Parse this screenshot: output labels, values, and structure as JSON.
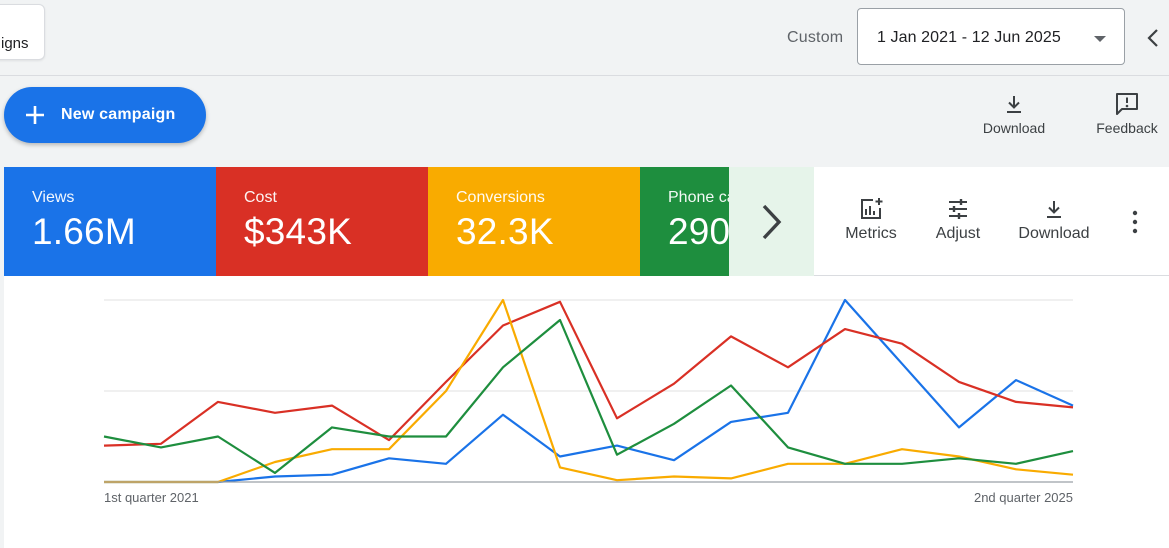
{
  "header": {
    "tab_label": "igns",
    "range_label": "Custom",
    "date_range": "1 Jan 2021 - 12 Jun 2025"
  },
  "actions": {
    "new_campaign": "New campaign",
    "download": "Download",
    "feedback": "Feedback"
  },
  "scorecards": [
    {
      "label": "Views",
      "value": "1.66M",
      "color": "#1a73e8"
    },
    {
      "label": "Cost",
      "value": "$343K",
      "color": "#d93025"
    },
    {
      "label": "Conversions",
      "value": "32.3K",
      "color": "#f9ab00"
    },
    {
      "label": "Phone calls",
      "value": "290",
      "color": "#1e8e3e"
    }
  ],
  "panel_tools": {
    "metrics": "Metrics",
    "adjust": "Adjust",
    "download": "Download"
  },
  "chart_data": {
    "type": "line",
    "x_tick_labels": [
      "1st quarter 2021",
      "2nd quarter 2025"
    ],
    "x": [
      1,
      2,
      3,
      4,
      5,
      6,
      7,
      8,
      9,
      10,
      11,
      12,
      13,
      14,
      15,
      16,
      17,
      18
    ],
    "ylim": [
      0,
      100
    ],
    "grid": true,
    "series": [
      {
        "color": "#1a73e8",
        "values": [
          0,
          0,
          0,
          3,
          4,
          13,
          10,
          37,
          14,
          20,
          12,
          33,
          38,
          100,
          65,
          30,
          56,
          42
        ]
      },
      {
        "color": "#d93025",
        "values": [
          20,
          21,
          44,
          38,
          42,
          23,
          55,
          86,
          99,
          35,
          54,
          80,
          63,
          84,
          76,
          55,
          44,
          41
        ]
      },
      {
        "color": "#f9ab00",
        "values": [
          0,
          0,
          0,
          11,
          18,
          18,
          50,
          100,
          8,
          1,
          3,
          2,
          10,
          10,
          18,
          14,
          7,
          4
        ]
      },
      {
        "color": "#1e8e3e",
        "values": [
          25,
          19,
          25,
          5,
          30,
          25,
          25,
          63,
          89,
          15,
          32,
          53,
          19,
          10,
          10,
          13,
          10,
          17
        ]
      }
    ]
  }
}
